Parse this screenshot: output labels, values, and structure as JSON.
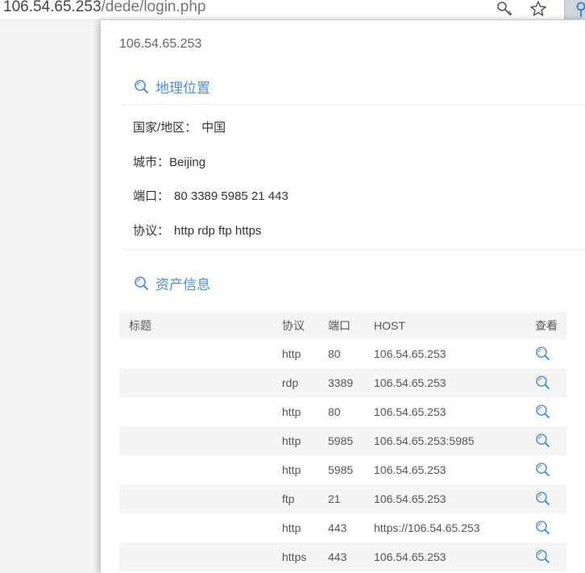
{
  "browser": {
    "url_host": "106.54.65.253",
    "url_path": "/dede/login.php"
  },
  "panel": {
    "ip": "106.54.65.253",
    "geo_section": {
      "title": "地理位置",
      "country_label": "国家/地区：",
      "country_value": "中国",
      "city_label": "城市：",
      "city_value": "Beijing",
      "port_label": "端口：",
      "port_value": "80 3389 5985 21 443",
      "protocol_label": "协议：",
      "protocol_value": "http rdp ftp https"
    },
    "asset_section": {
      "title": "资产信息",
      "columns": [
        "标题",
        "协议",
        "端口",
        "HOST",
        "查看"
      ],
      "rows": [
        {
          "title": "",
          "protocol": "http",
          "port": "80",
          "host": "106.54.65.253"
        },
        {
          "title": "",
          "protocol": "rdp",
          "port": "3389",
          "host": "106.54.65.253"
        },
        {
          "title": "",
          "protocol": "http",
          "port": "80",
          "host": "106.54.65.253"
        },
        {
          "title": "",
          "protocol": "http",
          "port": "5985",
          "host": "106.54.65.253:5985"
        },
        {
          "title": "",
          "protocol": "http",
          "port": "5985",
          "host": "106.54.65.253"
        },
        {
          "title": "",
          "protocol": "ftp",
          "port": "21",
          "host": "106.54.65.253"
        },
        {
          "title": "",
          "protocol": "http",
          "port": "443",
          "host": "https://106.54.65.253"
        },
        {
          "title": "",
          "protocol": "https",
          "port": "443",
          "host": "106.54.65.253"
        }
      ]
    }
  },
  "icons": {
    "key": "key-icon",
    "favorite": "star-icon",
    "extension": "extension-icon",
    "section": "search-icon",
    "view": "search-icon"
  },
  "colors": {
    "accent": "#4a8fd8",
    "row_alt": "#f5f5f5"
  }
}
